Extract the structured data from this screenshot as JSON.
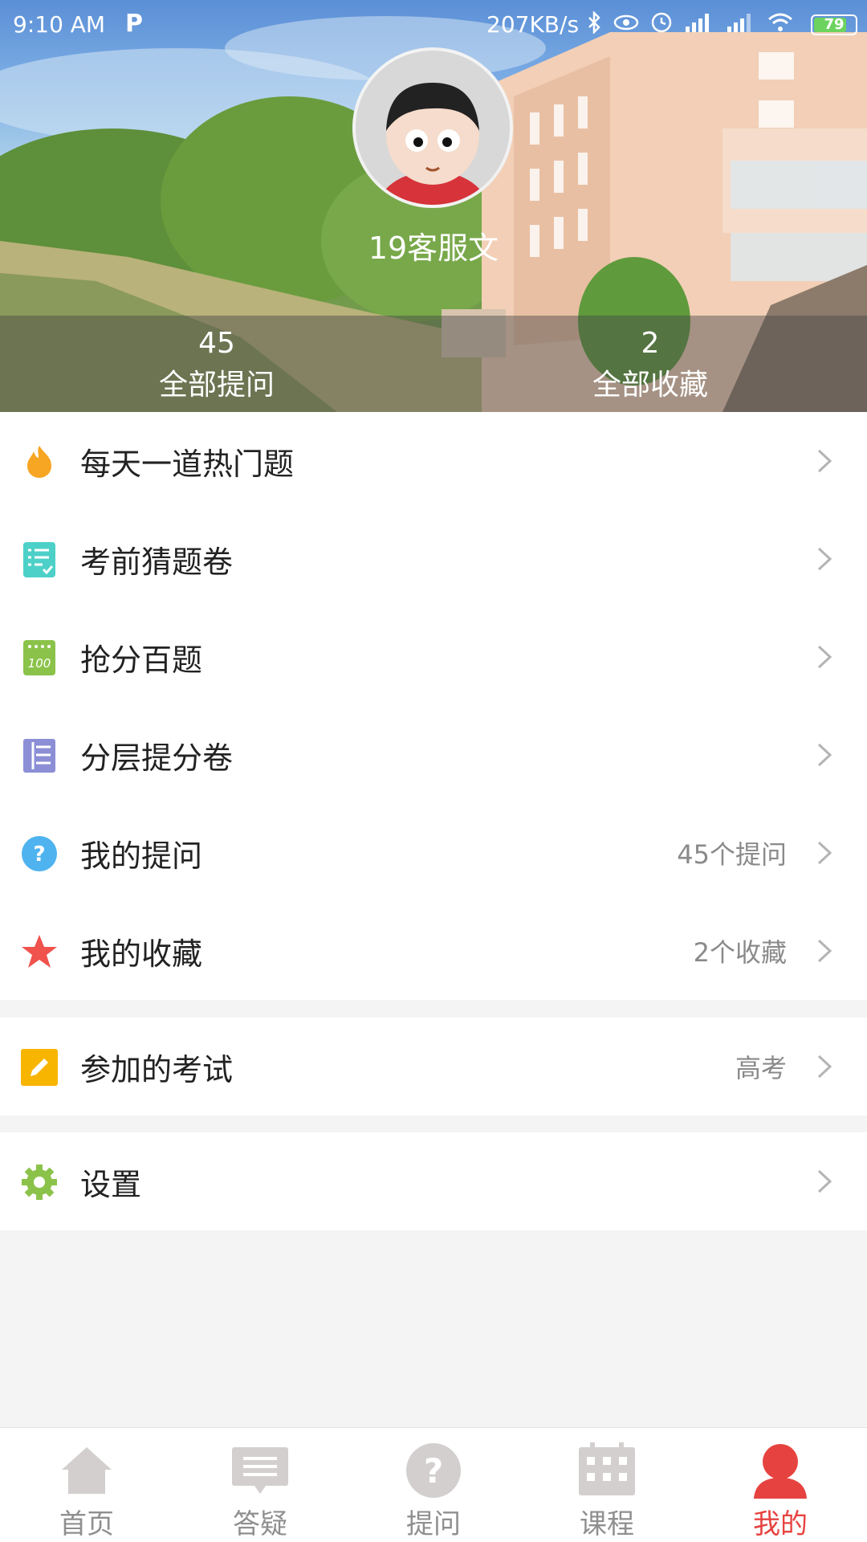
{
  "status_bar": {
    "time": "9:10  AM",
    "app_indicator": "P",
    "network_speed": "207KB/s",
    "battery": "79",
    "battery_level": 0.79
  },
  "profile": {
    "username": "19客服文",
    "stats": [
      {
        "value": "45",
        "label": "全部提问"
      },
      {
        "value": "2",
        "label": "全部收藏"
      }
    ]
  },
  "menu_groups": [
    {
      "items": [
        {
          "label": "每天一道热门题",
          "value": "",
          "icon": "flame-icon"
        },
        {
          "label": "考前猜题卷",
          "value": "",
          "icon": "checklist-icon"
        },
        {
          "label": "抢分百题",
          "value": "",
          "icon": "hundred-icon"
        },
        {
          "label": "分层提分卷",
          "value": "",
          "icon": "layers-icon"
        },
        {
          "label": "我的提问",
          "value": "45个提问",
          "icon": "question-icon"
        },
        {
          "label": "我的收藏",
          "value": "2个收藏",
          "icon": "star-icon"
        }
      ]
    },
    {
      "items": [
        {
          "label": "参加的考试",
          "value": "高考",
          "icon": "pencil-icon"
        }
      ]
    },
    {
      "items": [
        {
          "label": "设置",
          "value": "",
          "icon": "gear-icon"
        }
      ]
    }
  ],
  "bottom_nav": [
    {
      "label": "首页",
      "icon": "home-icon",
      "active": false
    },
    {
      "label": "答疑",
      "icon": "message-icon",
      "active": false
    },
    {
      "label": "提问",
      "icon": "question-icon",
      "active": false
    },
    {
      "label": "课程",
      "icon": "calendar-icon",
      "active": false
    },
    {
      "label": "我的",
      "icon": "user-icon",
      "active": true
    }
  ],
  "colors": {
    "accent": "#e64340",
    "nav_inactive": "#8f8f8f",
    "flame": "#f6a623",
    "checklist": "#4dd0c8",
    "hundred": "#8bc34a",
    "layers": "#8c8fd6",
    "question": "#4fb3f0",
    "star": "#f0524d",
    "pencil": "#f7b500",
    "gear": "#8bc34a"
  }
}
